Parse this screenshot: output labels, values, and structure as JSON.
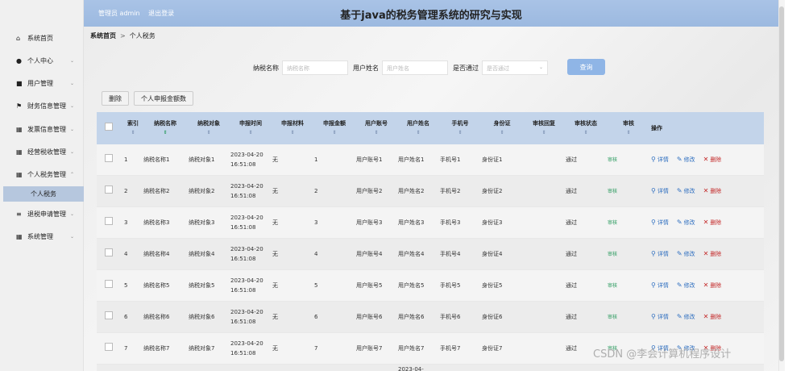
{
  "header": {
    "admin_label": "管理员 admin",
    "logout": "退出登录",
    "title": "基于java的税务管理系统的研究与实现"
  },
  "sidebar": {
    "items": [
      {
        "label": "系统首页",
        "icon": "home-icon",
        "glyph": "⌂"
      },
      {
        "label": "个人中心",
        "icon": "user-icon",
        "glyph": "●"
      },
      {
        "label": "用户管理",
        "icon": "card-icon",
        "glyph": "■"
      },
      {
        "label": "财务信息管理",
        "icon": "flag-icon",
        "glyph": "⚑"
      },
      {
        "label": "发票信息管理",
        "icon": "grid-icon",
        "glyph": "▦"
      },
      {
        "label": "经营税收管理",
        "icon": "grid-icon",
        "glyph": "▦"
      },
      {
        "label": "个人税务管理",
        "icon": "grid-icon",
        "glyph": "▦"
      },
      {
        "label": "退税申请管理",
        "icon": "list-icon",
        "glyph": "≡"
      },
      {
        "label": "系统管理",
        "icon": "grid-icon",
        "glyph": "▦"
      }
    ],
    "sub_item": "个人税务"
  },
  "breadcrumb": {
    "home": "系统首页",
    "sep": ">",
    "current": "个人税务"
  },
  "search": {
    "tax_name_label": "纳税名称",
    "tax_name_placeholder": "纳税名称",
    "user_name_label": "用户姓名",
    "user_name_placeholder": "用户姓名",
    "passed_label": "是否通过",
    "passed_placeholder": "是否通过",
    "query_button": "查询"
  },
  "actions": {
    "delete": "删除",
    "report": "个人申报金额数"
  },
  "table": {
    "headers": [
      "索引",
      "纳税名称",
      "纳税对象",
      "申报时间",
      "申报材料",
      "申报金额",
      "用户账号",
      "用户姓名",
      "手机号",
      "身份证",
      "审核回复",
      "审核状态",
      "审核",
      "操作"
    ],
    "audit_label": "审核",
    "detail_label": "详情",
    "edit_label": "修改",
    "delete_label": "删除",
    "rows": [
      {
        "idx": "1",
        "name": "纳税名称1",
        "obj": "纳税对象1",
        "time": "2023-04-20 16:51:08",
        "material": "无",
        "amount": "1",
        "account": "用户账号1",
        "uname": "用户姓名1",
        "phone": "手机号1",
        "idcard": "身份证1",
        "reply": "",
        "status": "通过"
      },
      {
        "idx": "2",
        "name": "纳税名称2",
        "obj": "纳税对象2",
        "time": "2023-04-20 16:51:08",
        "material": "无",
        "amount": "2",
        "account": "用户账号2",
        "uname": "用户姓名2",
        "phone": "手机号2",
        "idcard": "身份证2",
        "reply": "",
        "status": "通过"
      },
      {
        "idx": "3",
        "name": "纳税名称3",
        "obj": "纳税对象3",
        "time": "2023-04-20 16:51:08",
        "material": "无",
        "amount": "3",
        "account": "用户账号3",
        "uname": "用户姓名3",
        "phone": "手机号3",
        "idcard": "身份证3",
        "reply": "",
        "status": "通过"
      },
      {
        "idx": "4",
        "name": "纳税名称4",
        "obj": "纳税对象4",
        "time": "2023-04-20 16:51:08",
        "material": "无",
        "amount": "4",
        "account": "用户账号4",
        "uname": "用户姓名4",
        "phone": "手机号4",
        "idcard": "身份证4",
        "reply": "",
        "status": "通过"
      },
      {
        "idx": "5",
        "name": "纳税名称5",
        "obj": "纳税对象5",
        "time": "2023-04-20 16:51:08",
        "material": "无",
        "amount": "5",
        "account": "用户账号5",
        "uname": "用户姓名5",
        "phone": "手机号5",
        "idcard": "身份证5",
        "reply": "",
        "status": "通过"
      },
      {
        "idx": "6",
        "name": "纳税名称6",
        "obj": "纳税对象6",
        "time": "2023-04-20 16:51:08",
        "material": "无",
        "amount": "6",
        "account": "用户账号6",
        "uname": "用户姓名6",
        "phone": "手机号6",
        "idcard": "身份证6",
        "reply": "",
        "status": "通过"
      },
      {
        "idx": "7",
        "name": "纳税名称7",
        "obj": "纳税对象7",
        "time": "2023-04-20 16:51:08",
        "material": "无",
        "amount": "7",
        "account": "用户账号7",
        "uname": "用户姓名7",
        "phone": "手机号7",
        "idcard": "身份证7",
        "reply": "",
        "status": "通过"
      }
    ],
    "partial_row_time": "2023-04-"
  },
  "watermark": "CSDN @李会计算机程序设计"
}
